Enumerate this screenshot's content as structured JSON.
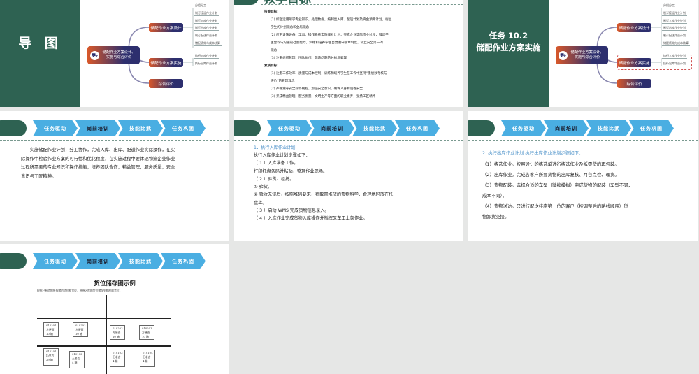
{
  "slide1": {
    "title": "导 图"
  },
  "mindmap": {
    "center": "储配作业方案设计、实施与综合评价",
    "branches": [
      {
        "label": "储配作业方案设计",
        "leaves": [
          "分组分工",
          "制订接运作业计划",
          "制订入库作业计划",
          "制订出库作业计划",
          "制订配送作业计划",
          "储配绩效与成本核算"
        ]
      },
      {
        "label": "储配作业方案实施",
        "leaves": [
          "执行入库作业计划",
          "执行出库作业计划"
        ]
      },
      {
        "label": "综合评价",
        "leaves": []
      }
    ]
  },
  "slide2": {
    "title": "教学目标",
    "lines": [
      {
        "t": "技能目标",
        "b": true
      },
      {
        "t": "(1) 综合运用所学专业知识，处理数据，编制出入库、配送计划及资金预算计划，树立"
      },
      {
        "t": "学生的计划观念和全局观念"
      },
      {
        "t": "(2) 应用设施设备、工具、操作系统实施作业计划，完成企业实际作业过程，锻炼学"
      },
      {
        "t": "生合作与沟通的社会能力，训练和培养学生自觉遵守规章制度，树立安全第一的"
      },
      {
        "t": "观念"
      },
      {
        "t": "(3) 注重组织管理、团队协作、现场问题的分析与处理"
      },
      {
        "t": "素质目标",
        "b": true
      },
      {
        "t": "(1) 注重工作效率、质量与成本控制，训练和培养学生在工作中坚持“重绩效考核与"
      },
      {
        "t": "评价”的管理理念"
      },
      {
        "t": "(2) 严格遵守安全操作规程，加强安全意识，确保人身和设备安全"
      },
      {
        "t": "(3)  养成精益管理、服务质量、文明生产等方面的职业素养，弘扬工匠精神"
      }
    ]
  },
  "slide3": {
    "title_line1": "任务 10.2",
    "title_line2": "储配作业方案实施"
  },
  "nav": [
    "任务驱动",
    "岗前培训",
    "技能比武",
    "任务巩固"
  ],
  "slide4": {
    "lines": [
      "　　实施储配作业计划，分工协作，完成入库、出库、配送作业实际操作，在实",
      "际操作中检验作业方案的可行性和优化程度，在实施过程中要体现物流企业作业",
      "过程所需要的专业知识和操作技能，培养团队合作，精益管理，服务质量，安全",
      "意识与工匠精神。"
    ]
  },
  "slide5": {
    "heading": " 1．执行入库作业计划",
    "lines": [
      "执行入库作业计划步骤如下：",
      "（ 1 ）入库准备工作。",
      "打印托盘条码并粘贴，整理作业现场。",
      "（ 2 ）验货、组托。",
      "① 验货。",
      "② 验收无误后，按照堆码要求，将散置堆放的货物科学、合理地码放在托",
      "盘上。",
      "（ 3 ）启动 WMS 完成货物信息录入。",
      "（ 4 ）入库作业完成货物入库操作并指挥叉车工上架作业。"
    ]
  },
  "slide6": {
    "heading": "2. 执行出库作业计划 执行出库作业计划步骤如下：",
    "lines": [
      "（1）拣选作业。按照设计的拣选单进行拣选作业及拆零货的再包装。",
      "（2）出库作业。完成各客户所要货物的出库复核、月台点检、理货。",
      "（3）货物配装。选择合适的车型（微缩模拟）完成货物的配装（车型不同，",
      "成本不同）。",
      "（4）货物送达。只进行配送排序第一位的客户（按调整后的路线顺序）货",
      "物卸货交接。"
    ]
  },
  "slide7": {
    "title": "货位储存图示例",
    "caption": "根据已有货物所存储的货位和货位，将待入库的货位储存到相应的货位。",
    "boxes": [
      [
        "010201",
        "方便面",
        "10 箱"
      ],
      [
        "010202",
        "方便面",
        "10 箱"
      ],
      [
        "010203",
        "方便面",
        "10 箱"
      ],
      [
        "010203",
        "方便面",
        "10 箱"
      ],
      [
        "010101",
        "巧克力",
        "29 箱"
      ],
      [
        "010102",
        "王老吉",
        "4 箱"
      ],
      [
        "010103",
        "王老吉",
        "4 箱"
      ],
      [
        "010104",
        "王老吉",
        "4 箱"
      ]
    ]
  }
}
